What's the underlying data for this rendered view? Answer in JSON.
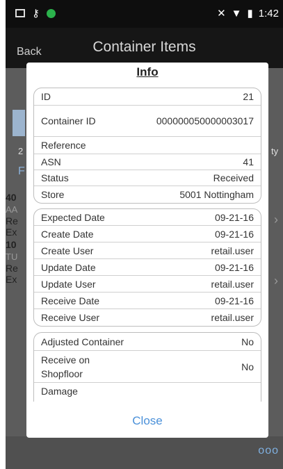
{
  "status_bar": {
    "time": "1:42"
  },
  "header": {
    "back_label": "Back",
    "title": "Container Items"
  },
  "background": {
    "frag_2": "2",
    "frag_f": "F",
    "frag_ty": "ty",
    "frag_40": "40",
    "frag_aa": "AA",
    "frag_re1": "Re",
    "frag_ex1": "Ex",
    "frag_10": "10",
    "frag_tu": "TU",
    "frag_re2": "Re",
    "frag_ex2": "Ex",
    "footer_dots": "ooo"
  },
  "dialog": {
    "title": "Info",
    "group1": [
      {
        "label": "ID",
        "value": "21"
      },
      {
        "label": "Container ID",
        "value": "000000050000003017"
      },
      {
        "label": "Reference",
        "value": ""
      },
      {
        "label": "ASN",
        "value": "41"
      },
      {
        "label": "Status",
        "value": "Received"
      },
      {
        "label": "Store",
        "value": "5001 Nottingham"
      }
    ],
    "group2": [
      {
        "label": "Expected Date",
        "value": "09-21-16"
      },
      {
        "label": "Create Date",
        "value": "09-21-16"
      },
      {
        "label": "Create User",
        "value": "retail.user"
      },
      {
        "label": "Update Date",
        "value": "09-21-16"
      },
      {
        "label": "Update User",
        "value": "retail.user"
      },
      {
        "label": "Receive Date",
        "value": "09-21-16"
      },
      {
        "label": "Receive User",
        "value": "retail.user"
      }
    ],
    "group3": [
      {
        "label": "Adjusted Container",
        "value": "No"
      },
      {
        "label": "Receive on Shopfloor",
        "value": "No"
      },
      {
        "label": "Damage",
        "value": ""
      }
    ],
    "close_label": "Close"
  }
}
